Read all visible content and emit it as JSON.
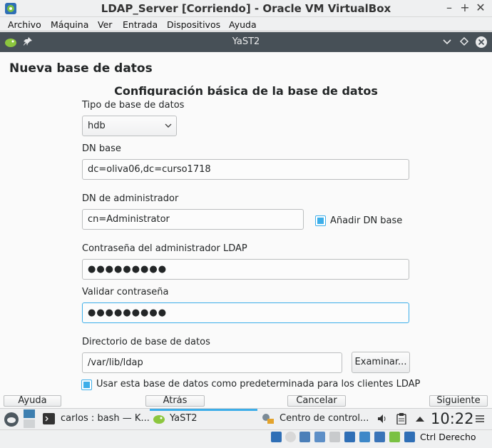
{
  "vbox": {
    "title": "LDAP_Server [Corriendo] - Oracle VM VirtualBox",
    "menu": [
      "Archivo",
      "Máquina",
      "Ver",
      "Entrada",
      "Dispositivos",
      "Ayuda"
    ],
    "controls": {
      "minimize": "–",
      "maximize": "+",
      "close": "✕"
    }
  },
  "yast": {
    "window_title": "YaST2",
    "page_title": "Nueva base de datos",
    "section_title": "Configuración básica de la base de datos",
    "db_type": {
      "label": "Tipo de base de datos",
      "value": "hdb"
    },
    "dn_base": {
      "label": "DN base",
      "value": "dc=oliva06,dc=curso1718"
    },
    "admin_dn": {
      "label": "DN de administrador",
      "value": "cn=Administrator",
      "append_label": "Añadir DN base",
      "append_checked": true
    },
    "admin_password": {
      "label": "Contraseña del administrador LDAP",
      "value": "●●●●●●●●●"
    },
    "validate_password": {
      "label": "Validar contraseña",
      "value": "●●●●●●●●●"
    },
    "db_dir": {
      "label": "Directorio de base de datos",
      "value": "/var/lib/ldap",
      "browse_label": "Examinar..."
    },
    "default_db": {
      "label": "Usar esta base de datos como predeterminada para los clientes LDAP",
      "checked": true
    },
    "buttons": {
      "help": "Ayuda",
      "back": "Atrás",
      "cancel": "Cancelar",
      "next": "Siguiente"
    }
  },
  "taskbar": {
    "tasks": [
      "carlos : bash — K...",
      "YaST2",
      "Centro de control..."
    ],
    "clock": "10:22"
  },
  "statusbar": {
    "host_key": "Ctrl Derecho"
  },
  "colors": {
    "accent": "#3daee9",
    "yast_titlebar": "#475057"
  }
}
